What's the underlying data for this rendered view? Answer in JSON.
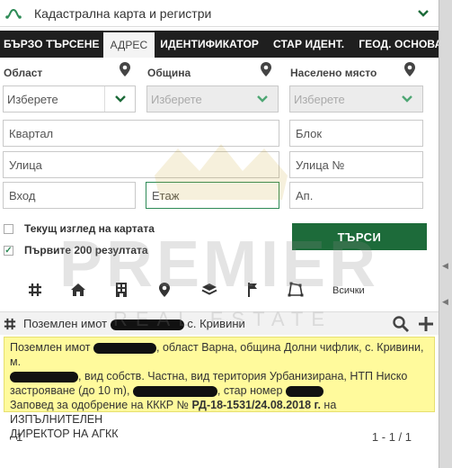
{
  "header": {
    "title": "Кадастрална карта и регистри",
    "app_icon": "route-icon",
    "collapse_icon": "chevron-down-icon"
  },
  "tabs": [
    {
      "label": "БЪРЗО ТЪРСЕНЕ",
      "active": false
    },
    {
      "label": "АДРЕС",
      "active": true
    },
    {
      "label": "ИДЕНТИФИКАТОР",
      "active": false
    },
    {
      "label": "СТАР ИДЕНТ.",
      "active": false
    },
    {
      "label": "ГЕОД. ОСНОВА",
      "active": false
    }
  ],
  "form": {
    "region_label": "Област",
    "municipality_label": "Община",
    "settlement_label": "Населено място",
    "region_select": "Изберете",
    "municipality_select": "Изберете",
    "settlement_select": "Изберете",
    "quarter": "Квартал",
    "block": "Блок",
    "street": "Улица",
    "street_no": "Улица №",
    "entrance": "Вход",
    "floor": "Етаж",
    "apartment": "Ап."
  },
  "options": {
    "current_view_label": "Текущ изглед на картата",
    "current_view_checked": false,
    "first200_label": "Първите 200 резултата",
    "first200_checked": true
  },
  "search_button": "ТЪРСИ",
  "toolbar": {
    "icons": [
      "grid-icon",
      "home-icon",
      "building-icon",
      "map-pin-icon",
      "layers-icon",
      "flag-icon",
      "polygon-icon"
    ],
    "all_label": "Всички"
  },
  "result": {
    "title_prefix": "Поземлен имот",
    "title_suffix": "с. Кривини",
    "line1_a": "Поземлен имот",
    "line1_b": ", област Варна, община Долни чифлик, с. Кривини, м.",
    "line2_b": ", вид собств. Частна, вид територия Урбанизирана, НТП Ниско",
    "line3_a": "застрояване (до 10 m),",
    "line3_b": ", стар номер",
    "line4_a": "Заповед за одобрение на КККР №",
    "line4_bold": "РД-18-1531/24.08.2018 г.",
    "line4_c": "на ИЗПЪЛНИТЕЛЕН",
    "line5": "ДИРЕКТОР НА АГКК"
  },
  "pager": {
    "page": "1",
    "count": "1 - 1 / 1"
  },
  "watermark": {
    "brand": "PREMIER",
    "sub": "REAL ESTATE"
  },
  "colors": {
    "accent_green": "#1d6b3a",
    "tab_bar": "#1f1f1f",
    "highlight_yellow": "#fffa9c"
  }
}
